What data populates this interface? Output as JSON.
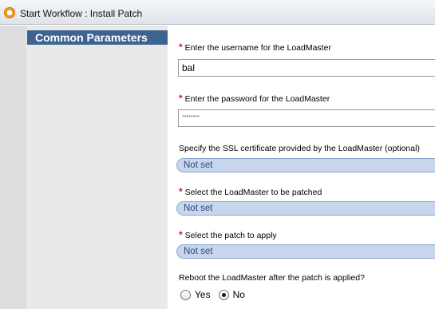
{
  "window": {
    "title": "Start Workflow : Install Patch"
  },
  "sidebar": {
    "section_title": "Common Parameters"
  },
  "form": {
    "username": {
      "label": "Enter the username for the LoadMaster",
      "value": "bal",
      "required": true
    },
    "password": {
      "label": "Enter the password for the LoadMaster",
      "value": "********",
      "required": true
    },
    "ssl_cert": {
      "label": "Specify the SSL certificate provided by the LoadMaster (optional)",
      "value": "Not set",
      "required": false
    },
    "loadmaster": {
      "label": "Select the LoadMaster to be patched",
      "value": "Not set",
      "required": true
    },
    "patch": {
      "label": "Select the patch to apply",
      "value": "Not set",
      "required": true
    },
    "reboot": {
      "label": "Reboot the LoadMaster after the patch is applied?",
      "options": [
        "Yes",
        "No"
      ],
      "selected": "No"
    },
    "required_marker": "*"
  },
  "colors": {
    "section_tab_bg": "#3d6390",
    "combo_bg": "#c7d6ec",
    "required_marker": "#d8141b"
  }
}
